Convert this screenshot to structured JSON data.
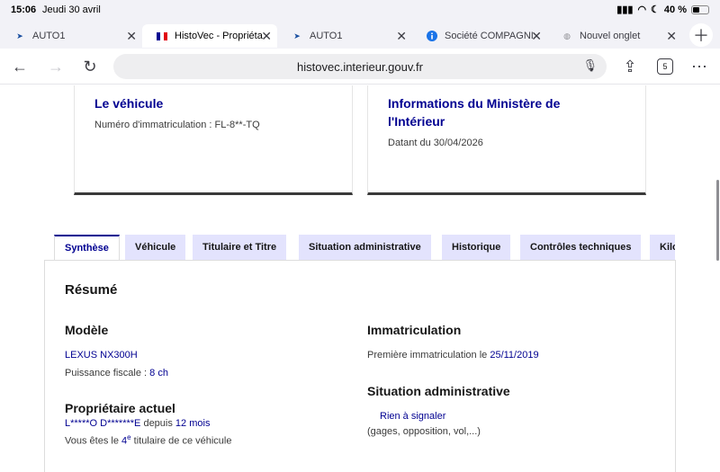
{
  "status": {
    "time": "15:06",
    "date": "Jeudi 30 avril",
    "battery": "40 %"
  },
  "tabs": [
    {
      "label": "AUTO1",
      "icon": "auto1-icon"
    },
    {
      "label": "HistoVec - Propriéta",
      "icon": "french-flag-icon"
    },
    {
      "label": "AUTO1",
      "icon": "auto1-icon"
    },
    {
      "label": "Société COMPAGNI",
      "icon": "info-icon"
    },
    {
      "label": "Nouvel onglet",
      "icon": "globe-icon"
    }
  ],
  "toolbar": {
    "url": "histovec.interieur.gouv.fr",
    "tab_count": "5"
  },
  "cards": {
    "vehicle": {
      "title": "Le véhicule",
      "plate": "Numéro d'immatriculation : FL-8**-TQ"
    },
    "ministry": {
      "title_line1": "Informations du Ministère de",
      "title_line2": "l'Intérieur",
      "date": "Datant du 30/04/2026"
    }
  },
  "page_tabs": [
    "Synthèse",
    "Véhicule",
    "Titulaire et Titre",
    "Situation administrative",
    "Historique",
    "Contrôles techniques",
    "Kilo"
  ],
  "summary": {
    "title": "Résumé",
    "model_heading": "Modèle",
    "model_value": "LEXUS NX300H",
    "power_label": "Puissance fiscale : ",
    "power_value": "8 ch",
    "owner_heading": "Propriétaire actuel",
    "owner_name": "L*****O D*******E",
    "owner_since_label": " depuis ",
    "owner_since_value": "12 mois",
    "owner_rank_prefix": "Vous êtes le ",
    "owner_rank_num": "4",
    "owner_rank_sup": "e",
    "owner_rank_suffix": " titulaire de ce véhicule",
    "registration_heading": "Immatriculation",
    "first_reg_label": "Première immatriculation le ",
    "first_reg_value": "25/11/2019",
    "admin_heading": "Situation administrative",
    "admin_value": "Rien à signaler",
    "admin_note": "(gages, opposition, vol,...)"
  }
}
